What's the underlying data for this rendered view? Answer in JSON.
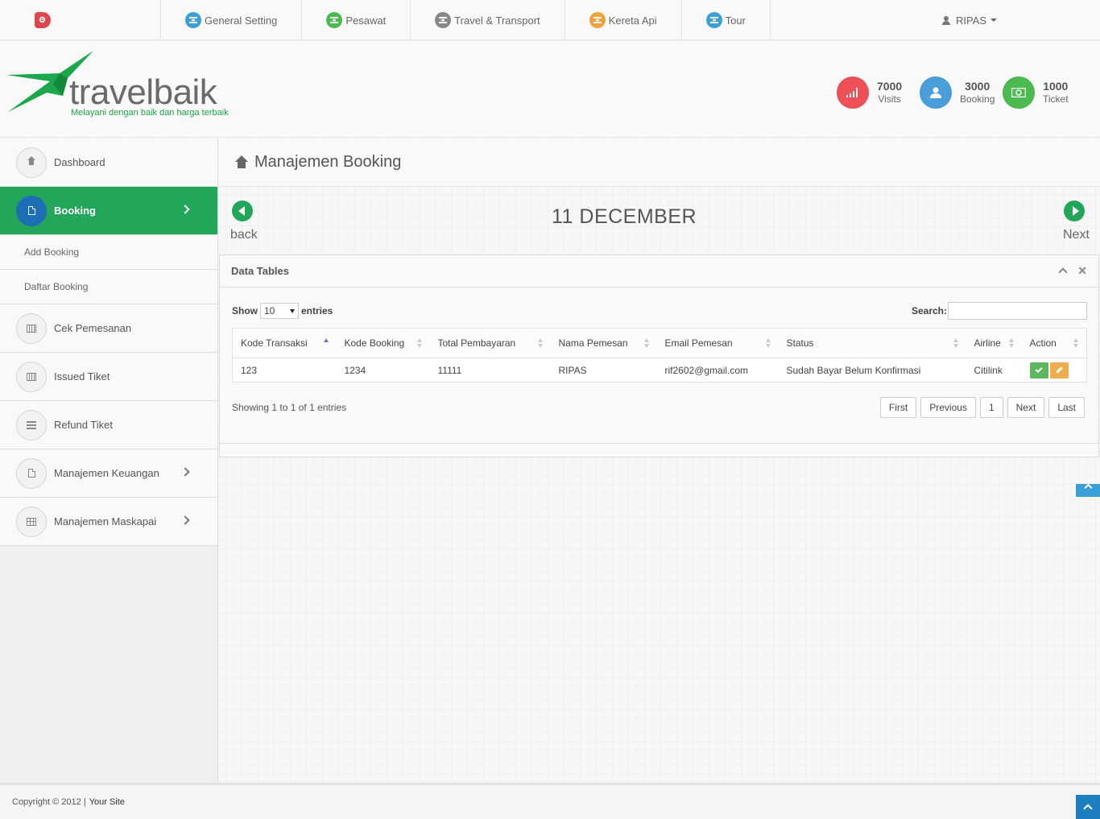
{
  "topnav": {
    "logo_icon": "gears-icon",
    "items": [
      {
        "label": "General Setting",
        "color": "#3aa0d6",
        "icon": "stack-icon"
      },
      {
        "label": "Pesawat",
        "color": "#4cbb4f",
        "icon": "stack-icon"
      },
      {
        "label": "Travel & Transport",
        "color": "#888888",
        "icon": "stack-icon"
      },
      {
        "label": "Kereta Api",
        "color": "#f0a33a",
        "icon": "stack-icon"
      },
      {
        "label": "Tour",
        "color": "#3aa0d6",
        "icon": "stack-icon"
      }
    ],
    "user": "RIPAS"
  },
  "brand": {
    "name": "travelbaik",
    "tagline": "Melayani dengan baik dan harga terbaik",
    "logo_color": "#1aa84a"
  },
  "stats": [
    {
      "value": "7000",
      "label": "Visits",
      "color": "#ef5056",
      "icon": "signal-icon"
    },
    {
      "value": "3000",
      "label": "Booking",
      "color": "#4a9fdb",
      "icon": "user-icon"
    },
    {
      "value": "1000",
      "label": "Ticket",
      "color": "#4cbb4f",
      "icon": "money-icon"
    }
  ],
  "sidebar": {
    "items": [
      {
        "label": "Dashboard",
        "icon": "home-icon"
      },
      {
        "label": "Booking",
        "icon": "document-icon",
        "active": true
      },
      {
        "label": "Cek Pemesanan",
        "icon": "chart-icon"
      },
      {
        "label": "Issued Tiket",
        "icon": "chart-icon"
      },
      {
        "label": "Refund Tiket",
        "icon": "list-icon"
      },
      {
        "label": "Manajemen Keuangan",
        "icon": "document-icon"
      },
      {
        "label": "Manajemen Maskapai",
        "icon": "grid-icon"
      }
    ],
    "sub_items": [
      {
        "label": "Add Booking"
      },
      {
        "label": "Daftar Booking"
      }
    ]
  },
  "main": {
    "title": "Manajemen Booking",
    "date": "11 DECEMBER",
    "back_label": "back",
    "next_label": "Next",
    "accent": "#21a65a"
  },
  "panel": {
    "title": "Data Tables",
    "show_label": "Show",
    "entries_label": "entries",
    "page_size": "10",
    "search_label": "Search:",
    "search_value": "",
    "columns": [
      "Kode Transaksi",
      "Kode Booking",
      "Total Pembayaran",
      "Nama Pemesan",
      "Email Pemesan",
      "Status",
      "Airline",
      "Action"
    ],
    "rows": [
      {
        "kode_transaksi": "123",
        "kode_booking": "1234",
        "total": "11111",
        "nama": "RIPAS",
        "email": "rif2602@gmail.com",
        "status": "Sudah Bayar Belum Konfirmasi",
        "airline": "Citilink"
      }
    ],
    "info": "Showing 1 to 1 of 1 entries",
    "pager": {
      "first": "First",
      "previous": "Previous",
      "page": "1",
      "next": "Next",
      "last": "Last"
    }
  },
  "footer": {
    "copyright": "Copyright © 2012 |",
    "site": "Your Site"
  }
}
